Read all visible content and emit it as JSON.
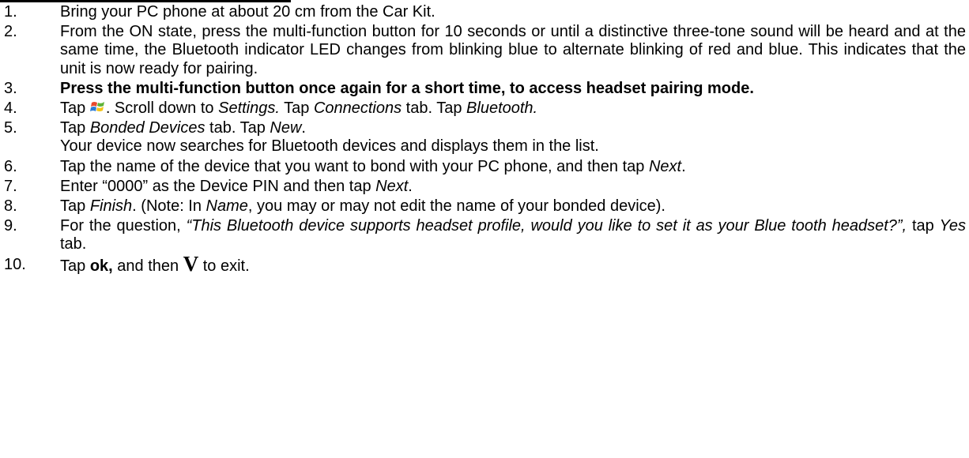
{
  "steps": [
    {
      "num": "1.",
      "text": "Bring your PC phone at about 20 cm from the Car Kit."
    },
    {
      "num": "2.",
      "text": "From the ON state, press the multi-function button for 10 seconds or until a distinctive three-tone sound will be heard and at the same time, the Bluetooth indicator LED changes from blinking blue to alternate blinking of red and blue.  This indicates that the unit is now ready for pairing."
    },
    {
      "num": "3.",
      "text": "Press the multi-function button once again for a short time, to access headset pairing mode."
    },
    {
      "num": "4.",
      "p1": "Tap ",
      "icon": "windows-start-icon",
      "p2": ". Scroll down to ",
      "settings": "Settings.",
      "p3": " Tap ",
      "connections": "Connections",
      "p4": " tab. Tap ",
      "bluetooth": "Bluetooth."
    },
    {
      "num": "5.",
      "p1": "Tap ",
      "bonded": "Bonded Devices",
      "p2": " tab. Tap ",
      "new": "New",
      "p3": ".",
      "continuation": "Your device now searches for Bluetooth devices and displays them in the list."
    },
    {
      "num": "6.",
      "p1": "Tap the name of the device that you want to bond with your PC phone, and then tap ",
      "next": "Next",
      "p2": "."
    },
    {
      "num": "7.",
      "p1": "Enter “0000” as the Device PIN and then tap ",
      "next": "Next",
      "p2": "."
    },
    {
      "num": "8.",
      "p1": "Tap ",
      "finish": "Finish",
      "p2": ".  (Note: In ",
      "name": "Name",
      "p3": ", you may or may not edit the name of your bonded device)."
    },
    {
      "num": "9.",
      "p1": "For the question, ",
      "question": "“This Bluetooth device supports headset profile, would you like to set it as your Blue tooth headset?”,",
      "p2": " tap ",
      "yes": "Yes",
      "p3": " tab."
    },
    {
      "num": "10.",
      "p1": "Tap ",
      "ok": "ok,",
      "p2": " and then ",
      "v": "V",
      "p3": " to exit."
    }
  ]
}
